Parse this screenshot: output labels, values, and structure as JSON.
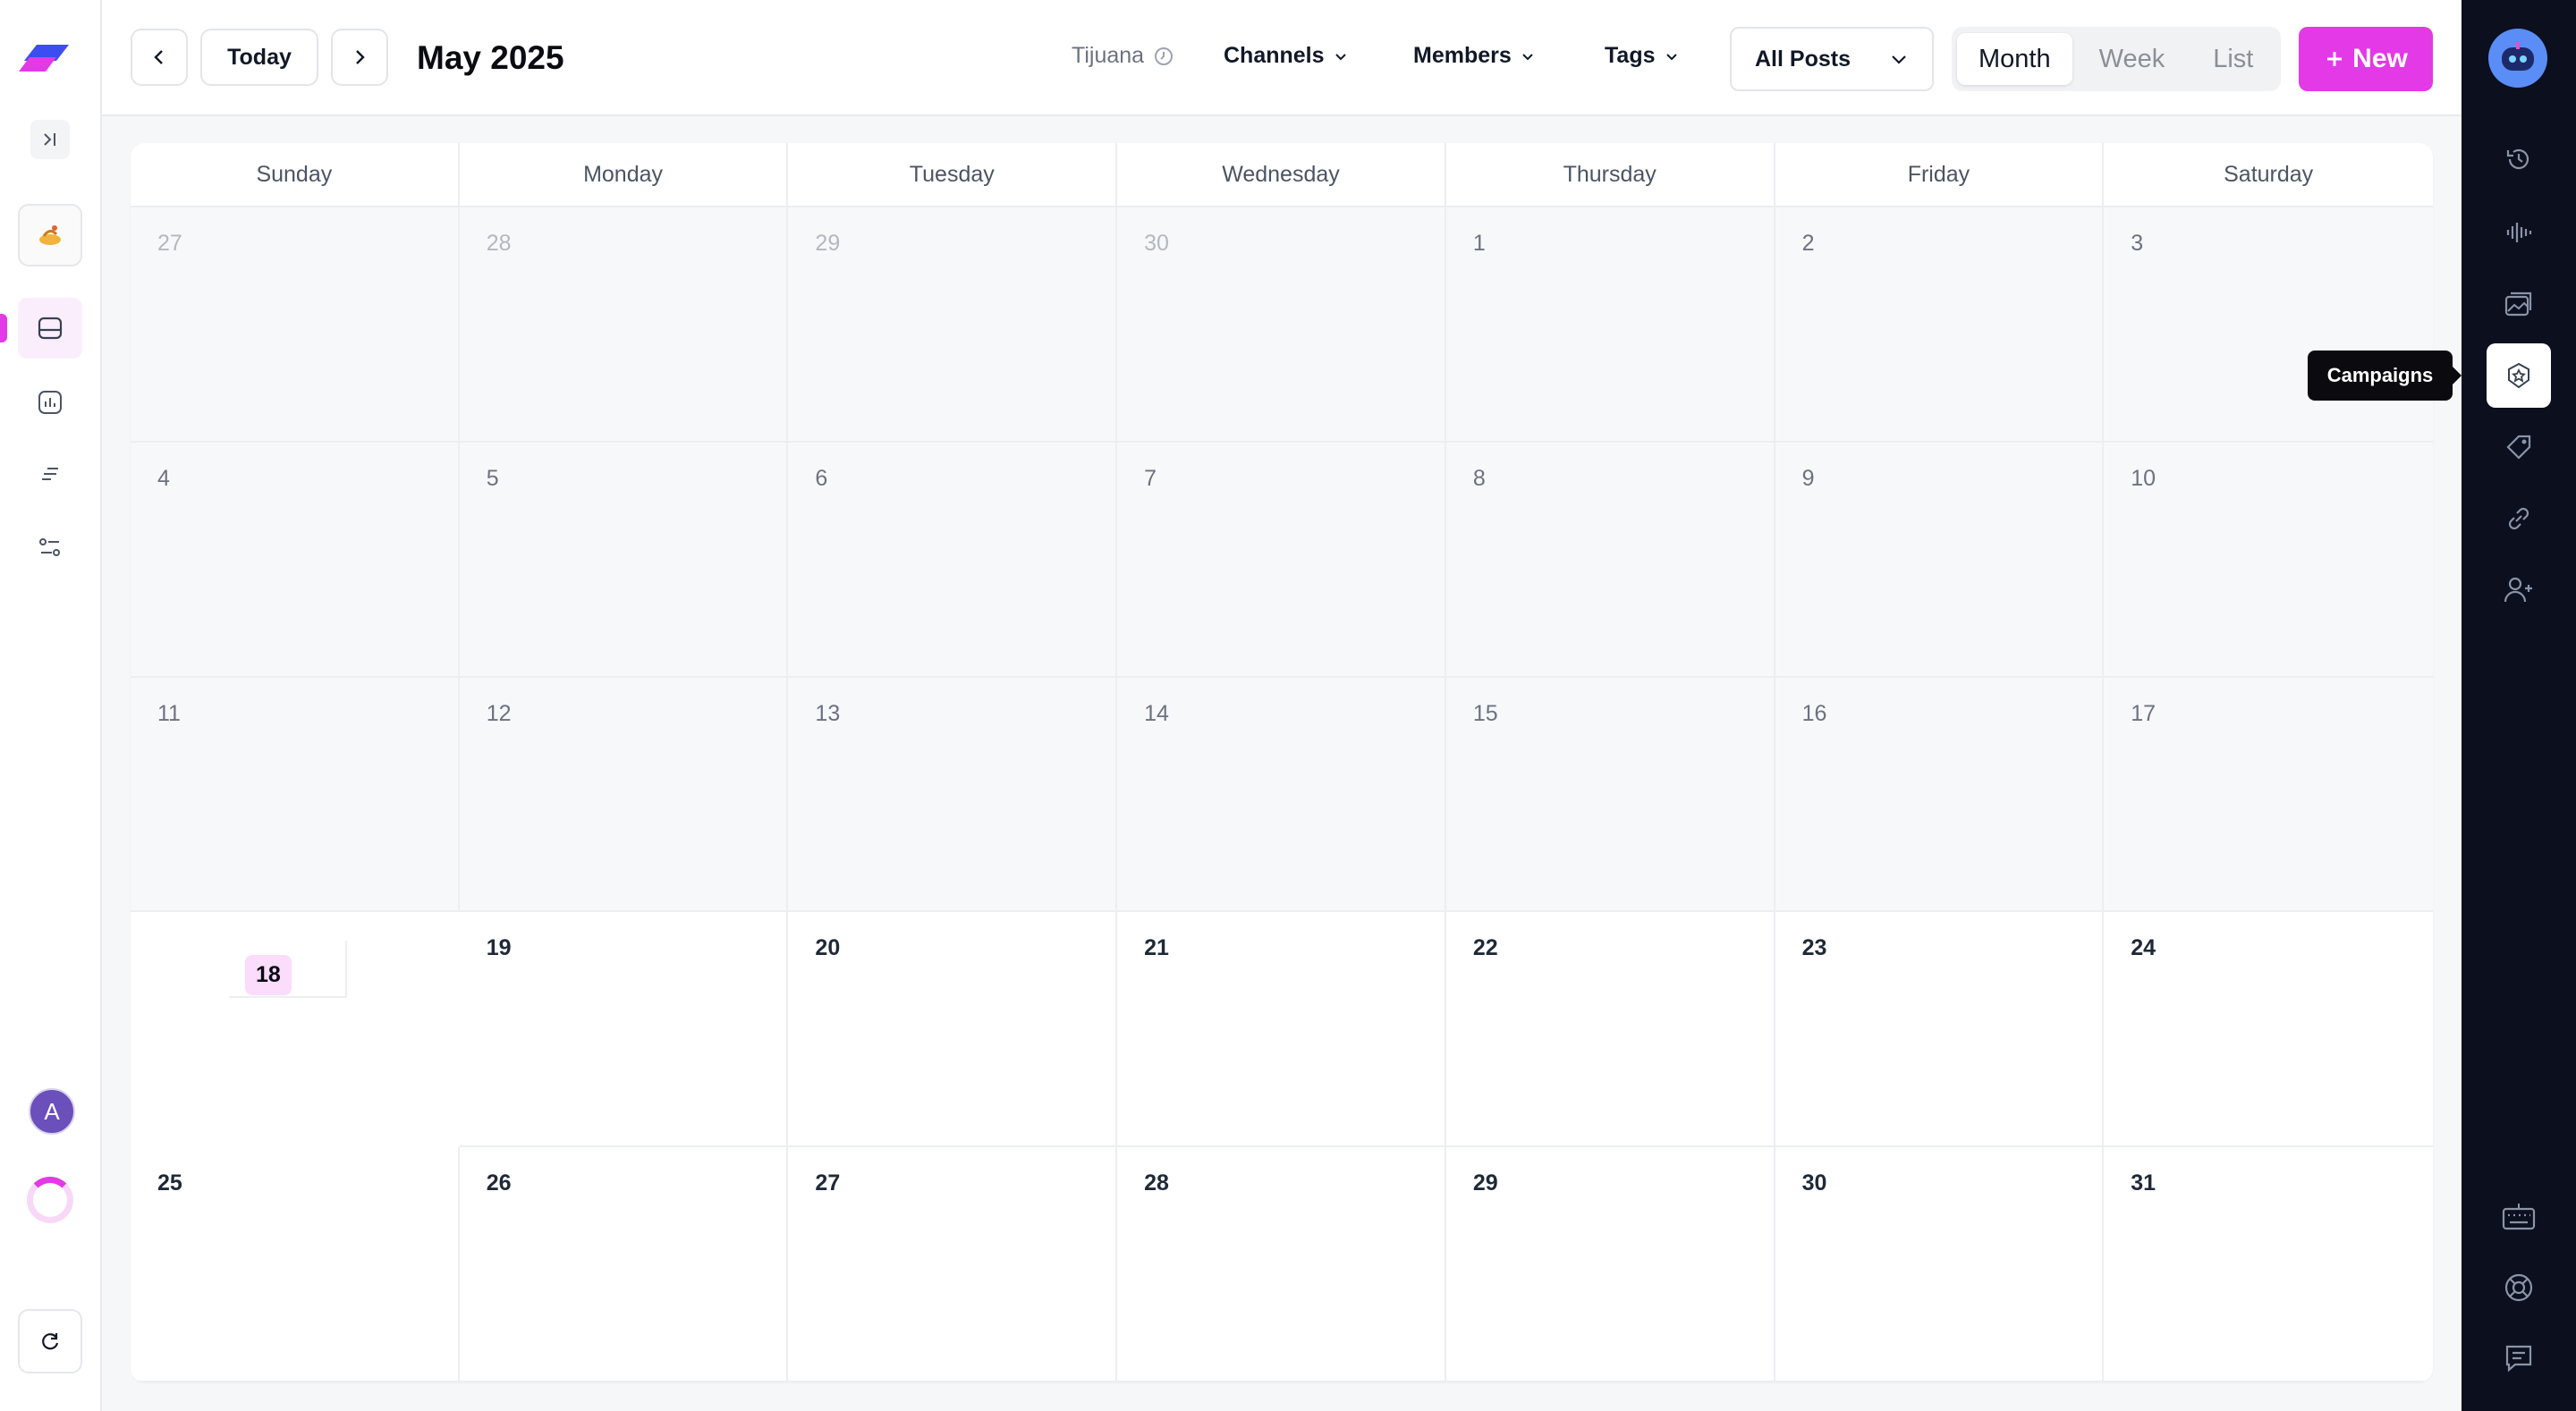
{
  "header": {
    "today_label": "Today",
    "month_title": "May 2025",
    "timezone": "Tijuana",
    "filters": {
      "channels": "Channels",
      "members": "Members",
      "tags": "Tags"
    },
    "post_filter": "All Posts",
    "views": [
      "Month",
      "Week",
      "List"
    ],
    "active_view": "Month",
    "new_button": "New"
  },
  "calendar": {
    "weekdays": [
      "Sunday",
      "Monday",
      "Tuesday",
      "Wednesday",
      "Thursday",
      "Friday",
      "Saturday"
    ],
    "weeks": [
      [
        "27",
        "28",
        "29",
        "30",
        "1",
        "2",
        "3"
      ],
      [
        "4",
        "5",
        "6",
        "7",
        "8",
        "9",
        "10"
      ],
      [
        "11",
        "12",
        "13",
        "14",
        "15",
        "16",
        "17"
      ],
      [
        "18",
        "19",
        "20",
        "21",
        "22",
        "23",
        "24"
      ],
      [
        "25",
        "26",
        "27",
        "28",
        "29",
        "30",
        "31"
      ]
    ],
    "today": "18"
  },
  "user": {
    "avatar_initial": "A"
  },
  "right_rail": {
    "tooltip": "Campaigns"
  },
  "colors": {
    "accent": "#e339e6",
    "rail_bg": "#0b0f1e"
  },
  "icons": {
    "left": [
      "logo-icon",
      "collapse-sidebar-icon",
      "workspace-icon",
      "calendar-icon",
      "analytics-icon",
      "queue-icon",
      "settings-icon",
      "refresh-icon"
    ],
    "right": [
      "assistant-bot-icon",
      "history-icon",
      "audio-wave-icon",
      "media-icon",
      "campaigns-icon",
      "tag-icon",
      "link-icon",
      "add-user-icon",
      "keyboard-icon",
      "help-icon",
      "feedback-icon"
    ]
  }
}
